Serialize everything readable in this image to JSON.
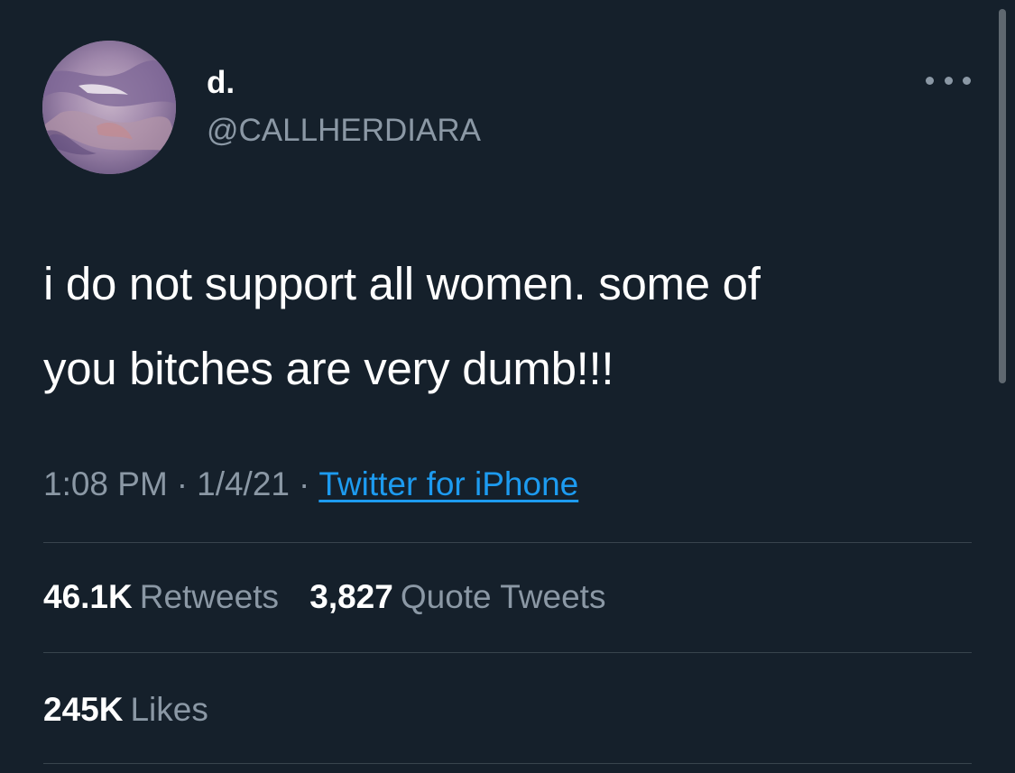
{
  "tweet": {
    "author": {
      "display_name": "d.",
      "handle": "@CALLHERDIARA"
    },
    "text_lines": [
      "i do not support all women. some of",
      "you bitches are very dumb!!!"
    ],
    "time": "1:08 PM",
    "separator": "·",
    "date": "1/4/21",
    "source": "Twitter for iPhone"
  },
  "stats": {
    "retweets": {
      "count": "46.1K",
      "label": "Retweets"
    },
    "quote_tweets": {
      "count": "3,827",
      "label": "Quote Tweets"
    },
    "likes": {
      "count": "245K",
      "label": "Likes"
    }
  },
  "icons": {
    "more": "more-horizontal-icon",
    "avatar": "profile-avatar"
  },
  "colors": {
    "background": "#15202b",
    "primary_text": "#ffffff",
    "secondary_text": "#8b98a5",
    "link": "#1d9bf0",
    "divider": "#38444d"
  }
}
